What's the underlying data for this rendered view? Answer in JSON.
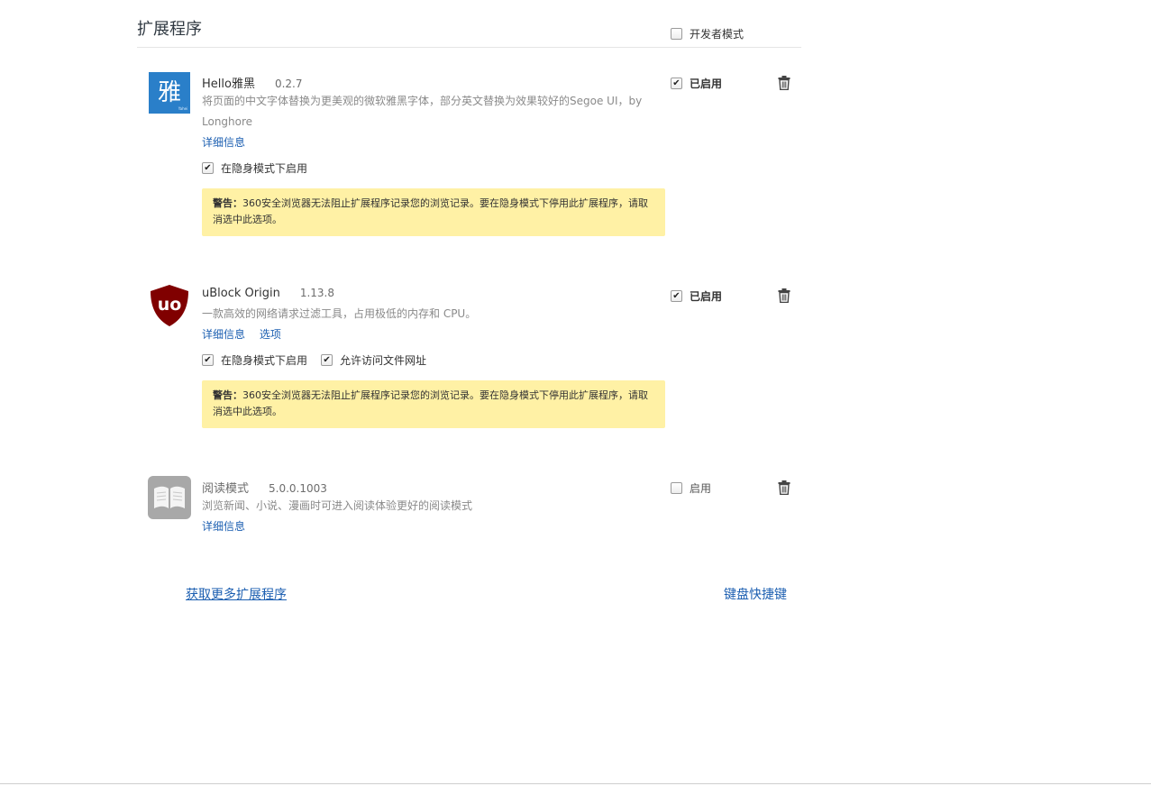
{
  "page": {
    "title": "扩展程序"
  },
  "developer_mode": {
    "label": "开发者模式",
    "checked": false
  },
  "extensions": [
    {
      "name": "Hello雅黑",
      "version": "0.2.7",
      "description": "将页面的中文字体替换为更美观的微软雅黑字体，部分英文替换为效果较好的Segoe UI，by Longhore",
      "links": [
        "详细信息"
      ],
      "options": [
        {
          "label": "在隐身模式下启用",
          "checked": true
        }
      ],
      "warning_prefix": "警告：",
      "warning_text": "360安全浏览器无法阻止扩展程序记录您的浏览记录。要在隐身模式下停用此扩展程序，请取消选中此选项。",
      "enabled_label": "已启用",
      "enabled": true,
      "icon": "yahei-icon",
      "icon_glyph": "雅",
      "icon_subtext": "Yahei",
      "icon_color": "#2a7fc9"
    },
    {
      "name": "uBlock Origin",
      "version": "1.13.8",
      "description": "一款高效的网络请求过滤工具，占用极低的内存和 CPU。",
      "links": [
        "详细信息",
        "选项"
      ],
      "options": [
        {
          "label": "在隐身模式下启用",
          "checked": true
        },
        {
          "label": "允许访问文件网址",
          "checked": true
        }
      ],
      "warning_prefix": "警告：",
      "warning_text": "360安全浏览器无法阻止扩展程序记录您的浏览记录。要在隐身模式下停用此扩展程序，请取消选中此选项。",
      "enabled_label": "已启用",
      "enabled": true,
      "icon": "ublock-shield-icon",
      "icon_glyph": "uo",
      "icon_color": "#800000"
    },
    {
      "name": "阅读模式",
      "version": "5.0.0.1003",
      "description": "浏览新闻、小说、漫画时可进入阅读体验更好的阅读模式",
      "links": [
        "详细信息"
      ],
      "enabled_label": "启用",
      "enabled": false,
      "icon": "open-book-icon"
    }
  ],
  "footer": {
    "get_more": "获取更多扩展程序",
    "shortcuts": "键盘快捷键"
  },
  "colors": {
    "link": "#1c5fb1",
    "warning_bg": "#fff1a5"
  }
}
